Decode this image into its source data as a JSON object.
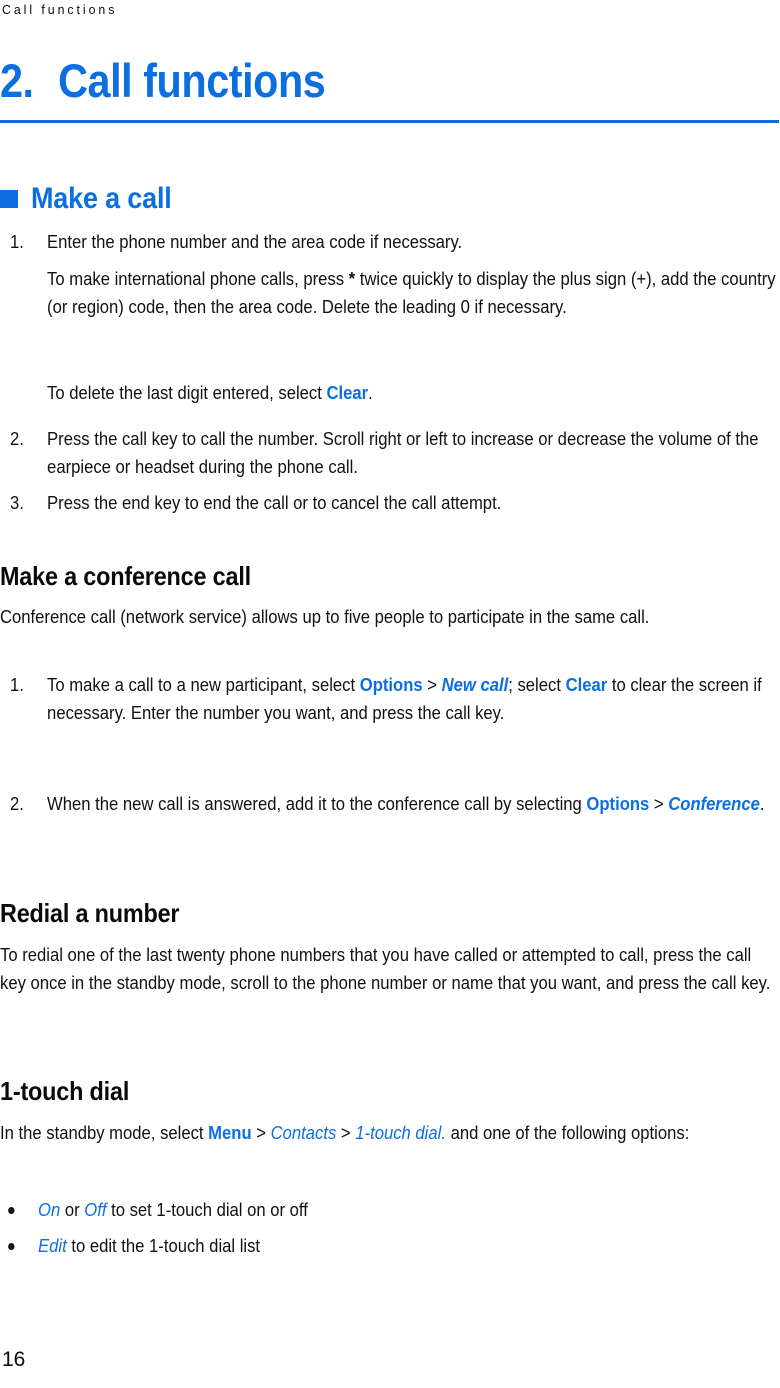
{
  "document": {
    "running_header": "Call functions",
    "page_number": "16",
    "accent_color": "#0d6ee0",
    "text_color": "#111111"
  },
  "chapter": {
    "number": "2.",
    "title": "Call functions"
  },
  "sections": [
    {
      "heading": "Make a call",
      "bullet_icon": "blue-square-bullet"
    }
  ],
  "make_a_call": {
    "items": [
      {
        "marker": "1.",
        "paragraphs": [
          "Enter the phone number and the area code if necessary.",
          "To make international phone calls, press * twice quickly to display the plus sign (+), add the country (or region) code, then the area code. Delete the leading 0 if necessary.",
          "To delete the last digit entered, select Clear."
        ]
      },
      {
        "marker": "2.",
        "text": "Press the call key to call the number. Scroll right or left to increase or decrease the volume of the earpiece or headset during the phone call."
      },
      {
        "marker": "3.",
        "text": "Press the end key to end the call or to cancel the call attempt."
      }
    ],
    "item1_p1": "Enter the phone number and the area code if necessary.",
    "item1_p2_a": "To make international phone calls, press ",
    "item1_p2_star": "*",
    "item1_p2_b": " twice quickly to display the plus sign (+), add the country (or region) code, then the area code. Delete the leading 0 if necessary.",
    "item1_p3_a": "To delete the last digit entered, select ",
    "item1_p3_clear": "Clear",
    "item1_p3_b": "."
  },
  "conference": {
    "heading": "Make a conference call",
    "intro": "Conference call (network service) allows up to five people to participate in the same call.",
    "item1": {
      "marker": "1.",
      "a": "To make a call to a new participant, select ",
      "options": "Options",
      "sep1": " > ",
      "new_call": "New call",
      "b": "; select ",
      "clear": "Clear",
      "c": " to clear the screen if necessary. Enter the number you want, and press the call key."
    },
    "item2": {
      "marker": "2.",
      "a": "When the new call is answered, add it to the conference call by selecting ",
      "options": "Options",
      "sep1": " > ",
      "conference": "Conference",
      "b": "."
    }
  },
  "redial": {
    "heading": "Redial a number",
    "body": "To redial one of the last twenty phone numbers that you have called or attempted to call, press the call key once in the standby mode, scroll to the phone number or name that you want, and press the call key."
  },
  "one_touch": {
    "heading": "1-touch dial",
    "intro_a": "In the standby mode, select ",
    "menu": "Menu",
    "sep1": " > ",
    "contacts": "Contacts",
    "sep2": " > ",
    "one_touch_dial": "1-touch dial.",
    "intro_b": " and one of the following options:",
    "bullets": [
      {
        "on": "On",
        "or": " or ",
        "off": "Off",
        "rest": " to set 1-touch dial on or off"
      },
      {
        "edit": "Edit",
        "rest": " to edit the 1-touch dial list"
      }
    ]
  }
}
